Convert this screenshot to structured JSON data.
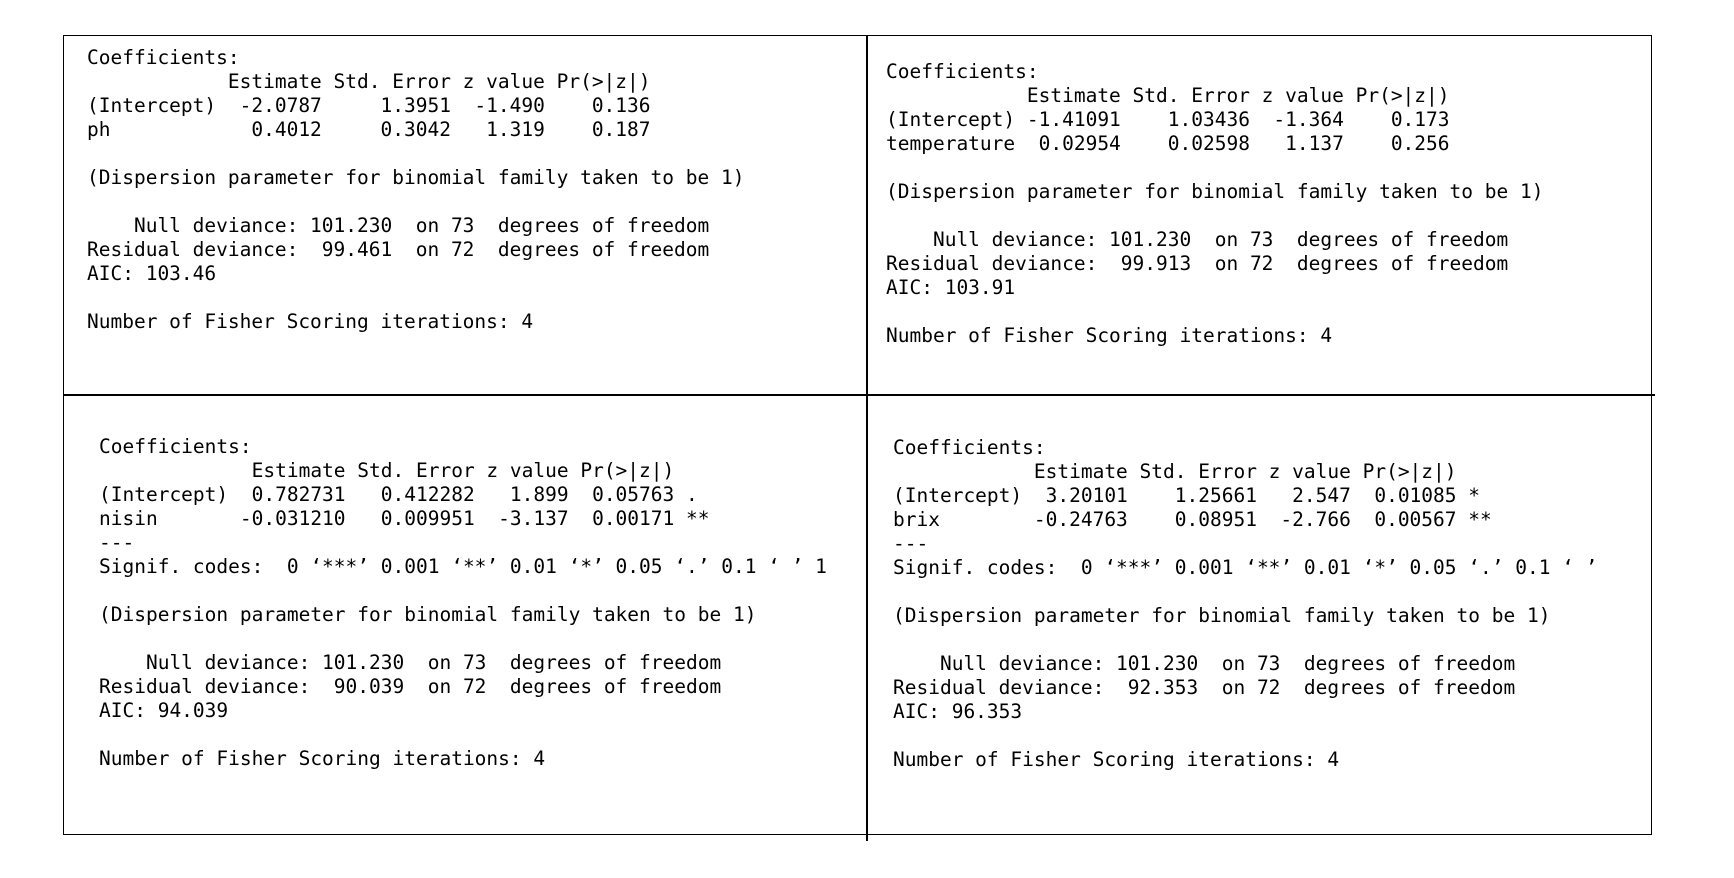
{
  "panels": {
    "top_left": {
      "lines": [
        "Coefficients:",
        "            Estimate Std. Error z value Pr(>|z|)",
        "(Intercept)  -2.0787     1.3951  -1.490    0.136",
        "ph            0.4012     0.3042   1.319    0.187",
        "",
        "(Dispersion parameter for binomial family taken to be 1)",
        "",
        "    Null deviance: 101.230  on 73  degrees of freedom",
        "Residual deviance:  99.461  on 72  degrees of freedom",
        "AIC: 103.46",
        "",
        "Number of Fisher Scoring iterations: 4"
      ]
    },
    "top_right": {
      "lines": [
        "Coefficients:",
        "            Estimate Std. Error z value Pr(>|z|)",
        "(Intercept) -1.41091    1.03436  -1.364    0.173",
        "temperature  0.02954    0.02598   1.137    0.256",
        "",
        "(Dispersion parameter for binomial family taken to be 1)",
        "",
        "    Null deviance: 101.230  on 73  degrees of freedom",
        "Residual deviance:  99.913  on 72  degrees of freedom",
        "AIC: 103.91",
        "",
        "Number of Fisher Scoring iterations: 4"
      ]
    },
    "bottom_left": {
      "lines": [
        "Coefficients:",
        "             Estimate Std. Error z value Pr(>|z|)",
        "(Intercept)  0.782731   0.412282   1.899  0.05763 .",
        "nisin       -0.031210   0.009951  -3.137  0.00171 **",
        "---",
        "Signif. codes:  0 ‘***’ 0.001 ‘**’ 0.01 ‘*’ 0.05 ‘.’ 0.1 ‘ ’ 1",
        "",
        "(Dispersion parameter for binomial family taken to be 1)",
        "",
        "    Null deviance: 101.230  on 73  degrees of freedom",
        "Residual deviance:  90.039  on 72  degrees of freedom",
        "AIC: 94.039",
        "",
        "Number of Fisher Scoring iterations: 4"
      ]
    },
    "bottom_right": {
      "lines": [
        "Coefficients:",
        "            Estimate Std. Error z value Pr(>|z|)",
        "(Intercept)  3.20101    1.25661   2.547  0.01085 *",
        "brix        -0.24763    0.08951  -2.766  0.00567 **",
        "---",
        "Signif. codes:  0 ‘***’ 0.001 ‘**’ 0.01 ‘*’ 0.05 ‘.’ 0.1 ‘ ’",
        "",
        "(Dispersion parameter for binomial family taken to be 1)",
        "",
        "    Null deviance: 101.230  on 73  degrees of freedom",
        "Residual deviance:  92.353  on 72  degrees of freedom",
        "AIC: 96.353",
        "",
        "Number of Fisher Scoring iterations: 4"
      ]
    }
  }
}
